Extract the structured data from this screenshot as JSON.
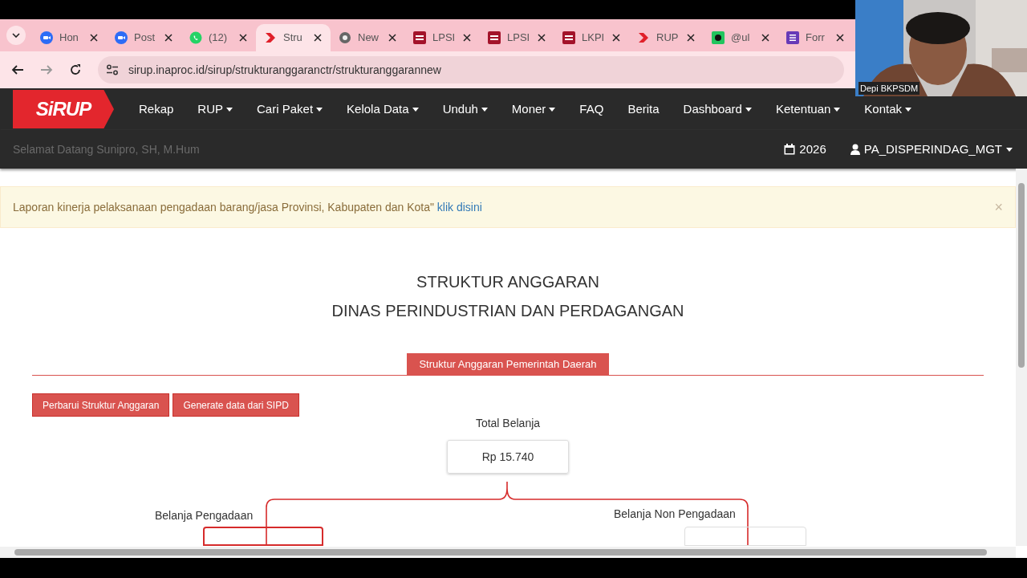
{
  "browser": {
    "tabs": [
      {
        "title": "Hon",
        "kind": "zoom",
        "selected": false
      },
      {
        "title": "Post",
        "kind": "zoom",
        "selected": false
      },
      {
        "title": "(12)",
        "kind": "whatsapp",
        "selected": false
      },
      {
        "title": "Stru",
        "kind": "sirup",
        "selected": true
      },
      {
        "title": "New",
        "kind": "chrome",
        "selected": false
      },
      {
        "title": "LPSI",
        "kind": "inaproc",
        "selected": false
      },
      {
        "title": "LPSI",
        "kind": "inaproc",
        "selected": false
      },
      {
        "title": "LKPI",
        "kind": "inaproc",
        "selected": false
      },
      {
        "title": "RUP",
        "kind": "sirup",
        "selected": false
      },
      {
        "title": "@ul",
        "kind": "green",
        "selected": false
      },
      {
        "title": "Forr",
        "kind": "form",
        "selected": false
      }
    ],
    "url": "sirup.inaproc.id/sirup/strukturanggaranctr/strukturanggarannew"
  },
  "video": {
    "name": "Depi BKPSDM"
  },
  "navbar": {
    "logo": "SiRUP",
    "items": [
      {
        "label": "Rekap",
        "dropdown": false
      },
      {
        "label": "RUP",
        "dropdown": true
      },
      {
        "label": "Cari Paket",
        "dropdown": true
      },
      {
        "label": "Kelola Data",
        "dropdown": true
      },
      {
        "label": "Unduh",
        "dropdown": true
      },
      {
        "label": "Moner",
        "dropdown": true
      },
      {
        "label": "FAQ",
        "dropdown": false
      },
      {
        "label": "Berita",
        "dropdown": false
      },
      {
        "label": "Dashboard",
        "dropdown": true
      },
      {
        "label": "Ketentuan",
        "dropdown": true
      },
      {
        "label": "Kontak",
        "dropdown": true
      }
    ],
    "welcome": "Selamat Datang Sunipro, SH, M.Hum",
    "year": "2026",
    "user": "PA_DISPERINDAG_MGT"
  },
  "alert": {
    "text": "Laporan kinerja pelaksanaan pengadaan barang/jasa Provinsi, Kabupaten dan Kota\"",
    "link": "klik disini",
    "close": "×"
  },
  "page": {
    "title_lines": [
      "STRUKTUR ANGGARAN",
      "DINAS PERINDUSTRIAN DAN PERDAGANGAN"
    ],
    "section_tab": "Struktur Anggaran Pemerintah Daerah",
    "buttons": [
      "Perbarui Struktur Anggaran",
      "Generate data dari SIPD"
    ],
    "total_label": "Total Belanja",
    "total_value": "Rp 15.740",
    "left_label": "Belanja Pengadaan",
    "right_label": "Belanja Non Pengadaan"
  }
}
